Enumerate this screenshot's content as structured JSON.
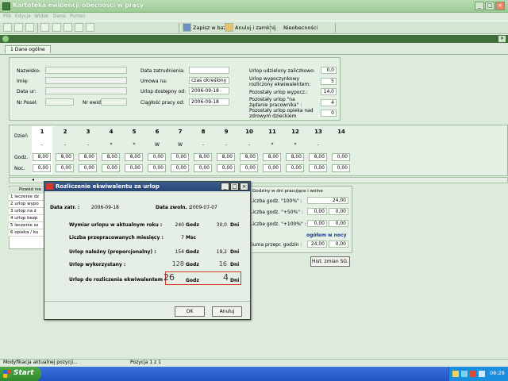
{
  "window": {
    "title": "Kartoteka ewidencji obecności w pracy"
  },
  "menu": [
    "Plik",
    "Edycje",
    "Widok",
    "Dane",
    "Pomoc"
  ],
  "toolbar": {
    "save_label": "Zapisz w bazie",
    "cancel_label": "Anuluj i zamknij",
    "absences_label": "Nieobecności"
  },
  "tab": {
    "label": "1 Dane ogólne"
  },
  "employee": {
    "nazwisko_label": "Nazwisko:",
    "imie_label": "Imię:",
    "data_ur_label": "Data ur:",
    "pesel_label": "Nr Pesel:",
    "nr_ewid_label": "Nr ewid.:",
    "data_zatr_label": "Data zatrudnienia:",
    "umowa_label": "Umowa na:",
    "umowa_value": "czas określony",
    "urlop_od_label": "Urlop dostępny od:",
    "urlop_od_value": "2006-09-18",
    "ciaglosc_label": "Ciągłość pracy od:",
    "ciaglosc_value": "2006-09-18"
  },
  "leave_info": [
    {
      "label": "Urlop udzielony zaliczkowo:",
      "value": "0,0"
    },
    {
      "label": "Urlop wypoczynkowy rozliczony ekwiwalentem:",
      "value": "5"
    },
    {
      "label": "Pozostały urlop wypocz.:",
      "value": "14,0"
    },
    {
      "label": "Pozostały urlop \"na żądanie pracownika\" :",
      "value": "4"
    },
    {
      "label": "Pozostały urlop opieka nad zdrowym dzieckiem",
      "value": "0"
    }
  ],
  "days": {
    "dzien_label": "Dzień",
    "godz_label": "Godz.",
    "noc_label": "Noc.",
    "numbers": [
      "1",
      "2",
      "3",
      "4",
      "5",
      "6",
      "7",
      "8",
      "9",
      "10",
      "11",
      "12",
      "13",
      "14"
    ],
    "subs": [
      "-",
      "-",
      "-",
      "*",
      "*",
      "W",
      "W",
      "-",
      "-",
      "-",
      "*",
      "*",
      "-",
      ""
    ],
    "godz": [
      "8,00",
      "8,00",
      "8,00",
      "8,00",
      "8,00",
      "0,00",
      "0,00",
      "8,00",
      "8,00",
      "8,00",
      "8,00",
      "8,00",
      "8,00",
      "0,00"
    ],
    "noc": [
      "0,00",
      "0,00",
      "0,00",
      "0,00",
      "0,00",
      "0,00",
      "0,00",
      "0,00",
      "0,00",
      "0,00",
      "0,00",
      "0,00",
      "0,00",
      "0,00"
    ]
  },
  "absence_list": {
    "header": "Powód nie",
    "rows": [
      "leczenie dz",
      "urlop wypo",
      "urlop na ż",
      "urlop bezp",
      "leczenie sz",
      "opieka / ku"
    ]
  },
  "hours_panel": {
    "title": "Godziny w dni pracujące i wolne",
    "rows": [
      {
        "label": "Liczba godz. \"100%\" :",
        "v1": "",
        "v2": "24,00"
      },
      {
        "label": "Liczba godz. \"+50%\" :",
        "v1": "0,00",
        "v2": "0,00"
      },
      {
        "label": "Liczba godz. \"+100%\" :",
        "v1": "0,00",
        "v2": "0,00"
      }
    ],
    "ogolem_label": "ogółem",
    "w_nocy_label": "w nocy",
    "suma_label": "Suma przepr. godzin :",
    "suma_v1": "24,00",
    "suma_v2": "0,00",
    "hist_button": "Hist. zmian SG."
  },
  "dialog": {
    "title": "Rozliczenie ekwiwalentu za urlop",
    "data_zatr_label": "Data zatr. :",
    "data_zatr_value": "2006-09-18",
    "data_zwoln_label": "Data zwoln. :",
    "data_zwoln_value": "2009-07-07",
    "rows": [
      {
        "label": "Wymiar urlopu w aktualnym roku :",
        "v1": "240",
        "u1": "Godz",
        "v2": "30,0",
        "u2": "Dni"
      },
      {
        "label": "Liczba przepracowanych miesięcy :",
        "v1": "7",
        "u1": "Msc",
        "v2": "",
        "u2": ""
      },
      {
        "label": "Urlop należny (proporcjonalny) :",
        "v1": "154",
        "u1": "Godz",
        "v2": "19,2",
        "u2": "Dni"
      },
      {
        "label": "Urlop wykorzystany :",
        "v1": "128",
        "u1": "Godz",
        "v2": "16",
        "u2": "Dni"
      },
      {
        "label": "Urlop do rozliczenia ekwiwalentem :",
        "v1": "26",
        "u1": "Godz",
        "v2": "4",
        "u2": "Dni"
      }
    ],
    "ok_label": "OK",
    "cancel_label": "Anuluj"
  },
  "status": {
    "left": "Modyfikacja aktualnej pozycji...",
    "mid": "Pozycja 1 z 1"
  },
  "taskbar": {
    "start_label": "Start",
    "clock": "08:29"
  }
}
